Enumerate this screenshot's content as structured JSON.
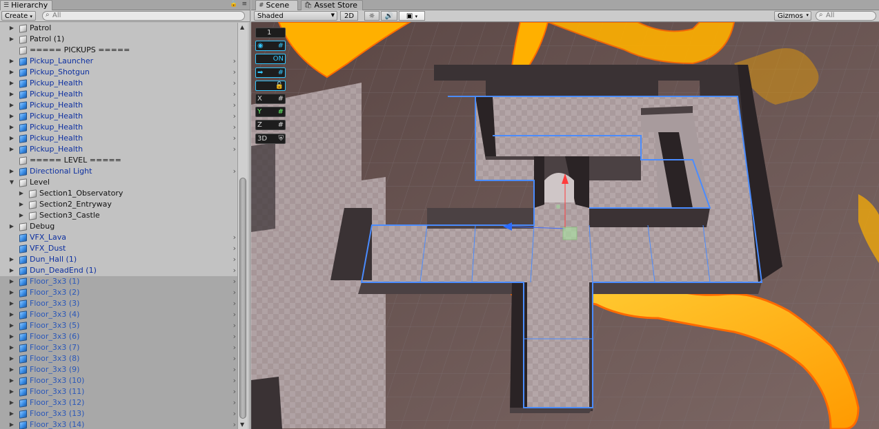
{
  "hierarchy": {
    "tab_label": "Hierarchy",
    "create_label": "Create",
    "search_placeholder": "All",
    "rows": [
      {
        "name": "Patrol",
        "fold": "▶",
        "icon": "plain",
        "color": "black",
        "depth": 1
      },
      {
        "name": "Patrol (1)",
        "fold": "▶",
        "icon": "plain",
        "color": "black",
        "depth": 1
      },
      {
        "name": "===== PICKUPS =====",
        "fold": "",
        "icon": "plain",
        "color": "black",
        "depth": 1
      },
      {
        "name": "Pickup_Launcher",
        "fold": "▶",
        "icon": "prefab",
        "color": "blue",
        "depth": 1,
        "chev": true
      },
      {
        "name": "Pickup_Shotgun",
        "fold": "▶",
        "icon": "prefab",
        "color": "blue",
        "depth": 1,
        "chev": true
      },
      {
        "name": "Pickup_Health",
        "fold": "▶",
        "icon": "prefab",
        "color": "blue",
        "depth": 1,
        "chev": true
      },
      {
        "name": "Pickup_Health",
        "fold": "▶",
        "icon": "prefab",
        "color": "blue",
        "depth": 1,
        "chev": true
      },
      {
        "name": "Pickup_Health",
        "fold": "▶",
        "icon": "prefab",
        "color": "blue",
        "depth": 1,
        "chev": true
      },
      {
        "name": "Pickup_Health",
        "fold": "▶",
        "icon": "prefab",
        "color": "blue",
        "depth": 1,
        "chev": true
      },
      {
        "name": "Pickup_Health",
        "fold": "▶",
        "icon": "prefab",
        "color": "blue",
        "depth": 1,
        "chev": true
      },
      {
        "name": "Pickup_Health",
        "fold": "▶",
        "icon": "prefab",
        "color": "blue",
        "depth": 1,
        "chev": true
      },
      {
        "name": "Pickup_Health",
        "fold": "▶",
        "icon": "prefab",
        "color": "blue",
        "depth": 1,
        "chev": true
      },
      {
        "name": "===== LEVEL =====",
        "fold": "",
        "icon": "plain",
        "color": "black",
        "depth": 1
      },
      {
        "name": "Directional Light",
        "fold": "▶",
        "icon": "prefab",
        "color": "blue",
        "depth": 1,
        "chev": true
      },
      {
        "name": "Level",
        "fold": "▼",
        "icon": "plain",
        "color": "black",
        "depth": 1
      },
      {
        "name": "Section1_Observatory",
        "fold": "▶",
        "icon": "plain",
        "color": "black",
        "depth": 2
      },
      {
        "name": "Section2_Entryway",
        "fold": "▶",
        "icon": "plain",
        "color": "black",
        "depth": 2
      },
      {
        "name": "Section3_Castle",
        "fold": "▶",
        "icon": "plain",
        "color": "black",
        "depth": 2
      },
      {
        "name": "Debug",
        "fold": "▶",
        "icon": "plain",
        "color": "black",
        "depth": 1
      },
      {
        "name": "VFX_Lava",
        "fold": "",
        "icon": "prefab",
        "color": "blue",
        "depth": 1,
        "chev": true
      },
      {
        "name": "VFX_Dust",
        "fold": "",
        "icon": "prefab",
        "color": "blue",
        "depth": 1,
        "chev": true
      },
      {
        "name": "Dun_Hall (1)",
        "fold": "▶",
        "icon": "prefab",
        "color": "blue",
        "depth": 1,
        "chev": true
      },
      {
        "name": "Dun_DeadEnd (1)",
        "fold": "▶",
        "icon": "prefab",
        "color": "blue",
        "depth": 1,
        "chev": true
      },
      {
        "name": "Floor_3x3 (1)",
        "fold": "▶",
        "icon": "prefab",
        "color": "blue-dim",
        "depth": 1,
        "chev": true,
        "dim": true
      },
      {
        "name": "Floor_3x3 (2)",
        "fold": "▶",
        "icon": "prefab",
        "color": "blue-dim",
        "depth": 1,
        "chev": true,
        "dim": true
      },
      {
        "name": "Floor_3x3 (3)",
        "fold": "▶",
        "icon": "prefab",
        "color": "blue-dim",
        "depth": 1,
        "chev": true,
        "dim": true
      },
      {
        "name": "Floor_3x3 (4)",
        "fold": "▶",
        "icon": "prefab",
        "color": "blue-dim",
        "depth": 1,
        "chev": true,
        "dim": true
      },
      {
        "name": "Floor_3x3 (5)",
        "fold": "▶",
        "icon": "prefab",
        "color": "blue-dim",
        "depth": 1,
        "chev": true,
        "dim": true
      },
      {
        "name": "Floor_3x3 (6)",
        "fold": "▶",
        "icon": "prefab",
        "color": "blue-dim",
        "depth": 1,
        "chev": true,
        "dim": true
      },
      {
        "name": "Floor_3x3 (7)",
        "fold": "▶",
        "icon": "prefab",
        "color": "blue-dim",
        "depth": 1,
        "chev": true,
        "dim": true
      },
      {
        "name": "Floor_3x3 (8)",
        "fold": "▶",
        "icon": "prefab",
        "color": "blue-dim",
        "depth": 1,
        "chev": true,
        "dim": true
      },
      {
        "name": "Floor_3x3 (9)",
        "fold": "▶",
        "icon": "prefab",
        "color": "blue-dim",
        "depth": 1,
        "chev": true,
        "dim": true
      },
      {
        "name": "Floor_3x3 (10)",
        "fold": "▶",
        "icon": "prefab",
        "color": "blue-dim",
        "depth": 1,
        "chev": true,
        "dim": true
      },
      {
        "name": "Floor_3x3 (11)",
        "fold": "▶",
        "icon": "prefab",
        "color": "blue-dim",
        "depth": 1,
        "chev": true,
        "dim": true
      },
      {
        "name": "Floor_3x3 (12)",
        "fold": "▶",
        "icon": "prefab",
        "color": "blue-dim",
        "depth": 1,
        "chev": true,
        "dim": true
      },
      {
        "name": "Floor_3x3 (13)",
        "fold": "▶",
        "icon": "prefab",
        "color": "blue-dim",
        "depth": 1,
        "chev": true,
        "dim": true
      },
      {
        "name": "Floor_3x3 (14)",
        "fold": "▶",
        "icon": "prefab",
        "color": "blue-dim",
        "depth": 1,
        "chev": true,
        "dim": true
      }
    ]
  },
  "scene": {
    "tab_scene": "Scene",
    "tab_asset_store": "Asset Store",
    "shading_mode": "Shaded",
    "mode_2d": "2D",
    "gizmos_label": "Gizmos",
    "search_placeholder": "All",
    "gizmo_tools": [
      {
        "left": "1",
        "right": "",
        "style": "plain"
      },
      {
        "left": "◉",
        "right": "#",
        "style": "cyan"
      },
      {
        "left": "",
        "right": "ON",
        "style": "cyan"
      },
      {
        "left": "➡",
        "right": "#",
        "style": "cyan"
      },
      {
        "left": "",
        "right": "🔓",
        "style": "cyan"
      },
      {
        "left": "X",
        "right": "#",
        "style": "plain"
      },
      {
        "left": "Y",
        "right": "#",
        "style": "plain"
      },
      {
        "left": "Z",
        "right": "#",
        "style": "plain"
      },
      {
        "left": "3D",
        "right": "⛨",
        "style": "plain"
      }
    ]
  },
  "colors": {
    "prefab_text": "#0c2fa0",
    "lava": "#ffb000",
    "floor": "#a8999b",
    "wall": "#3a3234",
    "selection_outline": "#4a8cff"
  }
}
